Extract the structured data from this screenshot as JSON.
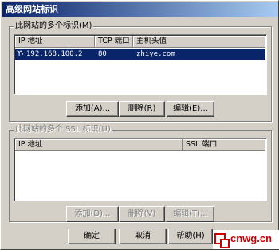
{
  "window": {
    "title": "高级网站标识"
  },
  "identities_group": {
    "label": "此网站的多个标识(M)",
    "columns": [
      "IP 地址",
      "TCP 端口",
      "主机头值"
    ],
    "rows": [
      {
        "ip": "192.168.100.2",
        "port": "80",
        "host": "zhiye.com",
        "selected": true
      }
    ],
    "buttons": {
      "add": "添加(A)...",
      "remove": "删除(R)",
      "edit": "编辑(E)..."
    }
  },
  "ssl_group": {
    "label": "此网站的多个 SSL 标识(U)",
    "columns": [
      "IP 地址",
      "SSL 端口"
    ],
    "rows": [],
    "buttons": {
      "add": "添加(D)...",
      "remove": "删除(V)",
      "edit": "编辑(T)..."
    }
  },
  "footer": {
    "ok": "确定",
    "cancel": "取消",
    "help": "帮助(H)"
  },
  "watermark": {
    "text": "cnwg.cn"
  },
  "colors": {
    "titlebar": "#0a246a",
    "selection": "#0a246a",
    "face": "#d4d0c8",
    "watermark": "#cc0000"
  },
  "icons": {
    "row": "network-ip-icon"
  }
}
